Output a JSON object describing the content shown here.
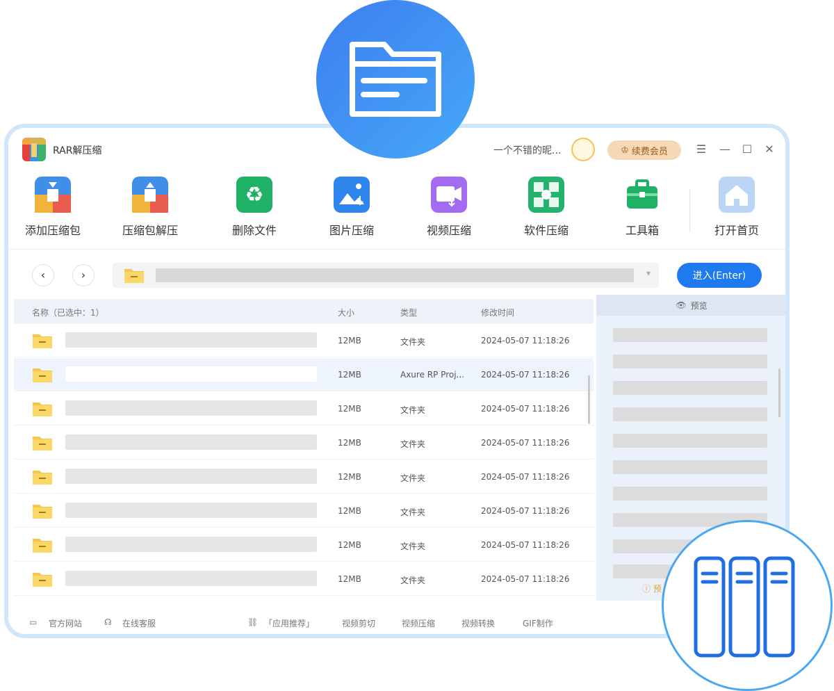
{
  "app": {
    "title": "RAR解压缩",
    "user_name": "一个不错的昵...",
    "vip_label": "续费会员"
  },
  "toolbar": [
    {
      "label": "添加压缩包"
    },
    {
      "label": "压缩包解压"
    },
    {
      "label": "删除文件"
    },
    {
      "label": "图片压缩"
    },
    {
      "label": "视频压缩"
    },
    {
      "label": "软件压缩"
    },
    {
      "label": "工具箱"
    },
    {
      "label": "打开首页"
    }
  ],
  "address_bar": {
    "enter_label": "进入(Enter)"
  },
  "file_list": {
    "columns": {
      "name": "名称（已选中：1）",
      "size": "大小",
      "type": "类型",
      "modified": "修改时间"
    },
    "rows": [
      {
        "size": "12MB",
        "type": "文件夹",
        "modified": "2024-05-07 11:18:26",
        "selected": false
      },
      {
        "size": "12MB",
        "type": "Axure RP Proj...",
        "modified": "2024-05-07 11:18:26",
        "selected": true
      },
      {
        "size": "12MB",
        "type": "文件夹",
        "modified": "2024-05-07 11:18:26",
        "selected": false
      },
      {
        "size": "12MB",
        "type": "文件夹",
        "modified": "2024-05-07 11:18:26",
        "selected": false
      },
      {
        "size": "12MB",
        "type": "文件夹",
        "modified": "2024-05-07 11:18:26",
        "selected": false
      },
      {
        "size": "12MB",
        "type": "文件夹",
        "modified": "2024-05-07 11:18:26",
        "selected": false
      },
      {
        "size": "12MB",
        "type": "文件夹",
        "modified": "2024-05-07 11:18:26",
        "selected": false
      },
      {
        "size": "12MB",
        "type": "文件夹",
        "modified": "2024-05-07 11:18:26",
        "selected": false
      }
    ]
  },
  "preview": {
    "title": "预览",
    "hint": "预"
  },
  "footer": {
    "official_site": "官方网站",
    "online_service": "在线客服",
    "recommend": "「应用推荐」",
    "links": [
      "视频剪切",
      "视频压缩",
      "视频转换",
      "GIF制作"
    ]
  },
  "colors": {
    "accent": "#1f7af0",
    "badge_gradient_start": "#3d7ef0",
    "badge_gradient_end": "#46a8f7",
    "window_border": "#cfe6fb",
    "folder": "#f6c64a",
    "vip_bg": "#f5d9b4"
  },
  "icons": {
    "top_badge": "folder-document-icon",
    "bottom_badge": "binders-icon"
  }
}
